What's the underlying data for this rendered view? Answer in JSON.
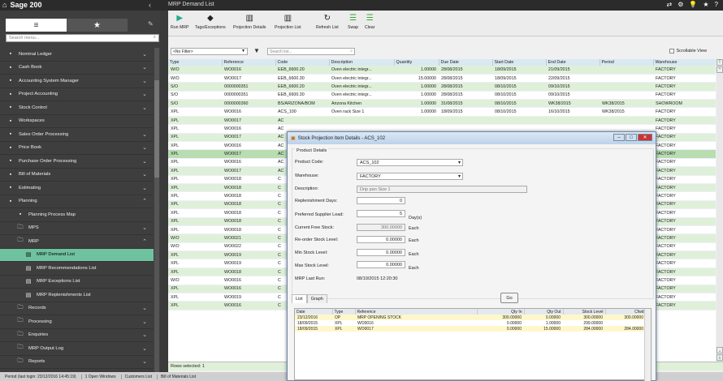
{
  "app": {
    "title": "Sage 200",
    "window_title": "MRP Demand List"
  },
  "sidebar": {
    "search_placeholder": "Search menu...",
    "items": [
      {
        "label": "Nominal Ledger",
        "icon": "ledger-icon"
      },
      {
        "label": "Cash Book",
        "icon": "book-icon"
      },
      {
        "label": "Accounting System Manager",
        "icon": "gear-icon"
      },
      {
        "label": "Project Accounting",
        "icon": "clipboard-icon"
      },
      {
        "label": "Stock Control",
        "icon": "stock-icon"
      },
      {
        "label": "Workspaces",
        "icon": "workspace-icon"
      },
      {
        "label": "Sales Order Processing",
        "icon": "sales-icon"
      },
      {
        "label": "Price Book",
        "icon": "price-icon"
      },
      {
        "label": "Purchase Order Processing",
        "icon": "purchase-icon"
      },
      {
        "label": "Bill of Materials",
        "icon": "bom-icon"
      },
      {
        "label": "Estimating",
        "icon": "estimating-icon"
      },
      {
        "label": "Planning",
        "icon": "planning-icon"
      },
      {
        "label": "Planning Process Map",
        "icon": "map-icon"
      },
      {
        "label": "MPS",
        "icon": "folder-icon"
      },
      {
        "label": "MRP",
        "icon": "folder-icon"
      },
      {
        "label": "MRP Demand List",
        "icon": "list-icon"
      },
      {
        "label": "MRP Recommendations List",
        "icon": "list-icon"
      },
      {
        "label": "MRP Exceptions List",
        "icon": "list-icon"
      },
      {
        "label": "MRP Replenishments List",
        "icon": "list-icon"
      },
      {
        "label": "Records",
        "icon": "folder-icon"
      },
      {
        "label": "Processing",
        "icon": "folder-icon"
      },
      {
        "label": "Enquiries",
        "icon": "folder-icon"
      },
      {
        "label": "MRP Output Log",
        "icon": "folder-icon"
      },
      {
        "label": "Reports",
        "icon": "folder-icon"
      }
    ]
  },
  "toolbar": {
    "run_mrp": "Run MRP",
    "tags": "Tags/Exceptions",
    "proj_details": "Projection Details",
    "proj_list": "Projection List",
    "refresh": "Refresh List",
    "swap": "Swap",
    "clear": "Clear"
  },
  "filter": {
    "value": "<No Filter>",
    "search_placeholder": "Search list...",
    "scrollable_view": "Scrollable View"
  },
  "grid": {
    "headers": [
      "Type",
      "Reference",
      "Code",
      "Description",
      "Quantity",
      "Due Date",
      "Start Date",
      "End Date",
      "Period",
      "Warehouse"
    ],
    "rows": [
      [
        "W/O",
        "WO0016",
        "EEB_6600.20",
        "Oven electric integr...",
        "1.00000",
        "28/08/2015",
        "18/09/2015",
        "21/09/2015",
        "",
        "FACTORY"
      ],
      [
        "W/O",
        "WO0017",
        "EEB_6600.30",
        "Oven electric integr...",
        "15.00000",
        "28/08/2015",
        "18/09/2015",
        "22/09/2015",
        "",
        "FACTORY"
      ],
      [
        "S/O",
        "0000000351",
        "EEB_6600.20",
        "Oven electric integr...",
        "1.00000",
        "28/08/2015",
        "08/10/2015",
        "09/10/2015",
        "",
        "FACTORY"
      ],
      [
        "S/O",
        "0000000351",
        "EEB_6600.30",
        "Oven electric integr...",
        "1.00000",
        "28/08/2015",
        "08/10/2015",
        "09/10/2015",
        "",
        "FACTORY"
      ],
      [
        "S/O",
        "0000000360",
        "BS/ARIZONA/BOM",
        "Arizona Kitchen",
        "1.00000",
        "31/08/2015",
        "08/10/2015",
        "WK38/2015",
        "WK38/2015",
        "SHOWROOM"
      ],
      [
        "XPL",
        "WO0016",
        "ACS_100",
        "Oven rack Size 1",
        "1.00000",
        "18/09/2015",
        "08/10/2015",
        "16/10/2015",
        "WK38/2015",
        "FACTORY"
      ],
      [
        "XPL",
        "WO0017",
        "AC",
        "",
        "",
        "",
        "",
        "",
        "",
        "FACTORY"
      ],
      [
        "XPL",
        "WO0016",
        "AC",
        "",
        "",
        "",
        "",
        "",
        "",
        "FACTORY"
      ],
      [
        "XPL",
        "WO0017",
        "AC",
        "",
        "",
        "",
        "",
        "",
        "",
        "FACTORY"
      ],
      [
        "XPL",
        "WO0016",
        "AC",
        "",
        "",
        "",
        "",
        "",
        "",
        "FACTORY"
      ],
      [
        "XPL",
        "WO0017",
        "AC",
        "",
        "",
        "",
        "",
        "",
        "",
        "FACTORY"
      ],
      [
        "XPL",
        "WO0016",
        "AC",
        "",
        "",
        "",
        "",
        "",
        "",
        "FACTORY"
      ],
      [
        "XPL",
        "WO0017",
        "AC",
        "",
        "",
        "",
        "",
        "",
        "",
        "FACTORY"
      ],
      [
        "XPL",
        "WO0018",
        "C",
        "",
        "",
        "",
        "",
        "",
        "",
        "FACTORY"
      ],
      [
        "XPL",
        "WO0018",
        "C",
        "",
        "",
        "",
        "",
        "",
        "",
        "FACTORY"
      ],
      [
        "XPL",
        "WO0018",
        "C",
        "",
        "",
        "",
        "",
        "",
        "",
        "FACTORY"
      ],
      [
        "XPL",
        "WO0018",
        "C",
        "",
        "",
        "",
        "",
        "",
        "",
        "FACTORY"
      ],
      [
        "XPL",
        "WO0018",
        "C",
        "",
        "",
        "",
        "",
        "",
        "",
        "FACTORY"
      ],
      [
        "XPL",
        "WO0018",
        "C",
        "",
        "",
        "",
        "",
        "",
        "",
        "FACTORY"
      ],
      [
        "XPL",
        "WO0018",
        "C",
        "",
        "",
        "",
        "",
        "",
        "",
        "FACTORY"
      ],
      [
        "W/O",
        "WO0021",
        "C",
        "",
        "",
        "",
        "",
        "",
        "",
        "FACTORY"
      ],
      [
        "W/O",
        "WO0022",
        "C",
        "",
        "",
        "",
        "",
        "",
        "",
        "FACTORY"
      ],
      [
        "XPL",
        "WO0019",
        "C",
        "",
        "",
        "",
        "",
        "",
        "",
        "FACTORY"
      ],
      [
        "XPL",
        "WO0019",
        "C",
        "",
        "",
        "",
        "",
        "",
        "",
        "FACTORY"
      ],
      [
        "XPL",
        "WO0018",
        "C",
        "",
        "",
        "",
        "",
        "",
        "",
        "FACTORY"
      ],
      [
        "W/O",
        "WO0016",
        "C",
        "",
        "",
        "",
        "",
        "",
        "",
        "FACTORY"
      ],
      [
        "XPL",
        "WO0016",
        "C",
        "",
        "",
        "",
        "",
        "",
        "",
        "FACTORY"
      ],
      [
        "XPL",
        "WO0019",
        "C",
        "",
        "",
        "",
        "",
        "",
        "",
        "FACTORY"
      ],
      [
        "XPL",
        "WO0016",
        "C",
        "",
        "",
        "",
        "",
        "",
        "",
        "FACTORY"
      ]
    ],
    "rows_selected": "Rows selected: 1"
  },
  "dialog": {
    "title": "Stock Projection Item Details - ACS_102",
    "section": "Product Details",
    "labels": {
      "product_code": "Product Code:",
      "warehouse": "Warehouse:",
      "description": "Description:",
      "replenishment_days": "Replenishment Days:",
      "supplier_lead": "Preferred Supplier Lead:",
      "free_stock": "Current Free Stock:",
      "reorder": "Re-order Stock Level:",
      "min_stock": "Min Stock Level:",
      "max_stock": "Max Stock Level:",
      "last_run": "MRP Last Run:"
    },
    "values": {
      "product_code": "ACS_102",
      "warehouse": "FACTORY",
      "description": "Drip pan Size 1",
      "replenishment_days": "0",
      "supplier_lead": "5",
      "free_stock": "300.00000",
      "reorder": "0.00000",
      "min_stock": "0.00000",
      "max_stock": "0.00000",
      "last_run": "08/10/2015 12:20:30"
    },
    "units": {
      "days": "Day(s)",
      "each": "Each"
    },
    "go": "Go",
    "tabs": [
      "List",
      "Graph"
    ],
    "list_headers": [
      "Date",
      "Type",
      "Reference",
      "Qty In",
      "Qty Out",
      "Stock Level",
      "Cfwd"
    ],
    "list_rows": [
      [
        "23/12/2016",
        "OP",
        "MRP OPENING STOCK",
        "300.00000",
        "0.00000",
        "300.00000",
        "300.00000"
      ],
      [
        "18/09/2015",
        "XPL",
        "WO0016",
        "0.00000",
        "1.00000",
        "299.00000",
        ""
      ],
      [
        "18/09/2015",
        "XPL",
        "WO0017",
        "0.00000",
        "15.00000",
        "284.00000",
        "284.00000"
      ]
    ]
  },
  "statusbar": {
    "items": [
      "Period (last login: 23/12/2016 14:45:19)",
      "1 Open Windows",
      "Customers List",
      "Bill of Materials List"
    ]
  }
}
